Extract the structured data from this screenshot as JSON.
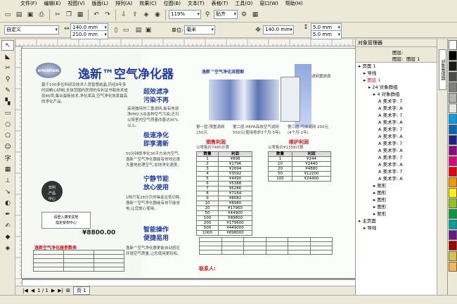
{
  "menu": [
    "文件(F)",
    "编辑(E)",
    "视图(V)",
    "版面(L)",
    "排列(A)",
    "效果(C)",
    "位图(B)",
    "文本(T)",
    "表格(T)",
    "工具(O)",
    "窗口(W)",
    "帮助(H)"
  ],
  "toolbar": {
    "zoom": "119%",
    "snap": "贴齐"
  },
  "props": {
    "paper": "自定义",
    "width": "140.0 mm",
    "height": "210.0 mm",
    "units_label": "单位:",
    "units": "毫米",
    "nudge": "140.0 mm",
    "dup_h": "5.0 mm",
    "dup_v": "5.0 mm"
  },
  "doc": {
    "brand": "逸新™空气净化器",
    "logo_text": "ATMOSPHERE",
    "intro": "基于100多位科研及技术人员智慧结晶,历经8年多时间精心研制,全球范围内获得的专利证书和技术成就46项,集合最新技术,净化率高,空气净化效率最高的净化产品。",
    "price": "¥8800.00",
    "badge": "安利\n产品\n中心",
    "contact_box": "请登入康安驻地\n指定受权中心",
    "h1": "超效滤净\n污染不再",
    "t1": "采用独特的三重滤网,能有效滤净PM2.5及各种空气污染,还可以将室内空气质量改善达95%以上。",
    "h2": "极速净化\n即享清新",
    "t2": "50分钟即净化36平方米内空气,逸新™空气净化器能有效地迅速大量地处理空气,加快净化速度。",
    "h3": "宁静节能\n放心使用",
    "t3": "1档只有28分贝的噪音且低功耗,逸新™空气净化器能有效节能省电,让您放心使用。",
    "h4": "智能操作\n便捷易用",
    "t4": "逸新™空气净化器更能自动感应环境空气质量,让您使用更轻松。",
    "diagram_title": "逸新™空气净化流程图",
    "side_label": "滤网置放面",
    "labels": [
      "第一层:预置滤网 150元",
      "第二层:HEPA高效空气滤网 550元(使用寿命3个月-5年)",
      "第三层:气味滤网 200元(4个月-1年)"
    ],
    "sales_title": "销售利润",
    "sales_sub": "以零售价7480计算",
    "sales_cols": [
      "数量",
      "利润"
    ],
    "sales_rows": [
      [
        "1",
        "¥898"
      ],
      [
        "2",
        "¥1796"
      ],
      [
        "3",
        "¥2694"
      ],
      [
        "4",
        "¥3592"
      ],
      [
        "5",
        "¥4490"
      ],
      [
        "6",
        "¥5388"
      ],
      [
        "7",
        "¥6286"
      ],
      [
        "8",
        "¥7184"
      ],
      [
        "9",
        "¥8082"
      ],
      [
        "10",
        "¥8980"
      ],
      [
        "20",
        "¥17960"
      ],
      [
        "50",
        "¥44900"
      ],
      [
        "100",
        "¥89800"
      ],
      [
        "200",
        "¥179600"
      ],
      [
        "500",
        "¥449000"
      ],
      [
        "1000",
        "¥898000"
      ]
    ],
    "maint_title": "维护利润",
    "maint_sub": "以零售价¥1358计算",
    "maint_cols": [
      "数量",
      "利润"
    ],
    "maint_rows": [
      [
        "1",
        "¥244"
      ],
      [
        "10",
        "¥2440"
      ],
      [
        "20",
        "¥4880"
      ],
      [
        "50",
        "¥12200"
      ],
      [
        "100",
        "¥24400"
      ]
    ],
    "contact": "联系人:",
    "bottom_title": "逸新空气净化器参数表"
  },
  "objmgr": {
    "title": "对象管理器",
    "layer_label": "图层:",
    "layer_value": "图层 1",
    "items": [
      "页面 1",
      "导线",
      "图层 1",
      "24 对象群组",
      "4 对象群组",
      "美术字: 7",
      "美术字: A",
      "美术字: 7",
      "美术字: A",
      "美术字: 7",
      "美术字: A",
      "美术字: 7",
      "美术字: A",
      "美术字: 7",
      "美术字: A",
      "美术字: 7",
      "美术字: A",
      "矩形",
      "图形",
      "图形",
      "图形",
      "矩形",
      "主页面",
      "导线"
    ]
  },
  "status": {
    "pager": "1 / 1",
    "page_tab": "页 1"
  },
  "colors": {
    "accent": "#1f3fae",
    "title_blue": "#223e9a",
    "red": "#c4161c",
    "green": "#3d7a2a"
  }
}
